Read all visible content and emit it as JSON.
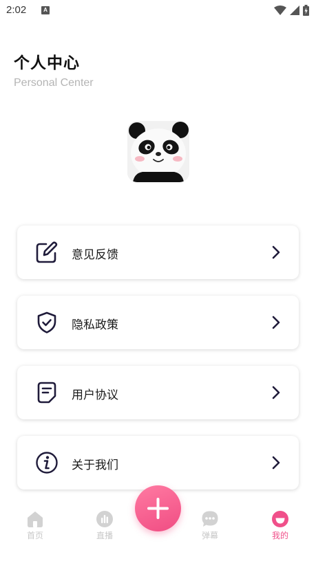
{
  "status_bar": {
    "time": "2:02",
    "notification_badge": "A",
    "icons": [
      "wifi-icon",
      "signal-icon",
      "battery-icon"
    ]
  },
  "header": {
    "title": "个人中心",
    "subtitle": "Personal Center"
  },
  "avatar": {
    "icon": "panda-avatar"
  },
  "menu": {
    "items": [
      {
        "label": "意见反馈",
        "icon": "feedback-edit-icon"
      },
      {
        "label": "隐私政策",
        "icon": "shield-check-icon"
      },
      {
        "label": "用户协议",
        "icon": "document-icon"
      },
      {
        "label": "关于我们",
        "icon": "info-icon"
      }
    ]
  },
  "tabbar": {
    "items": [
      {
        "label": "首页",
        "icon": "home-icon",
        "active": false
      },
      {
        "label": "直播",
        "icon": "live-icon",
        "active": false
      },
      {
        "label": "弹幕",
        "icon": "danmaku-chat-icon",
        "active": false
      },
      {
        "label": "我的",
        "icon": "profile-smile-icon",
        "active": true
      }
    ],
    "add_button": {
      "icon": "plus-icon"
    }
  },
  "colors": {
    "accent": "#f0508a",
    "inactive_tab": "#c8c8c8",
    "subtitle": "#b4b4b4",
    "icon_dark": "#1f1b3a"
  }
}
